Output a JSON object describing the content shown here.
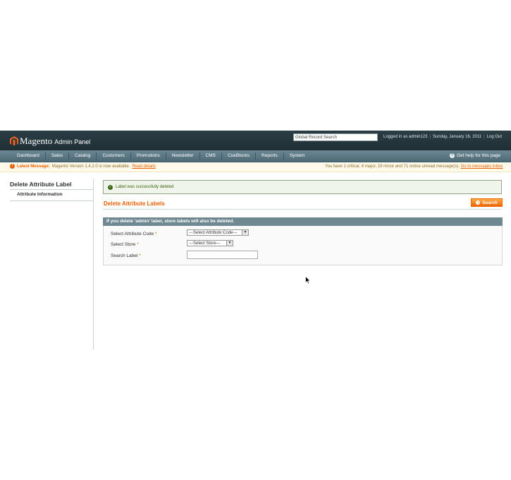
{
  "header": {
    "logo_text": "Magento",
    "logo_sub": "Admin Panel",
    "global_search_value": "Global Record Search",
    "user_info": [
      "Logged in as admin123",
      "Sunday, January 16, 2011",
      "Log Out"
    ]
  },
  "nav": {
    "items": [
      "Dashboard",
      "Sales",
      "Catalog",
      "Customers",
      "Promotions",
      "Newsletter",
      "CMS",
      "CueBlocks",
      "Reports",
      "System"
    ],
    "help_label": "Get help for this page"
  },
  "notice": {
    "label": "Latest Message:",
    "message": "Magento Version 1.4.2.0 is now available.",
    "link": "Read details",
    "right_text": "You have 1 critical, 4 major, 19 minor and 71 notice unread message(s).",
    "right_link": "Go to messages inbox"
  },
  "sidebar": {
    "title": "Delete Attribute Label",
    "tab": "Attribute Information"
  },
  "success_message": "Label was successfully deleted",
  "content": {
    "title": "Delete Attribute Labels",
    "search_button": "Search",
    "fieldset_legend": "If you delete 'admin' label, store labels will also be deleted.",
    "fields": {
      "attribute_code_label": "Select Attribute Code",
      "attribute_code_value": "---Select Attribute Code---",
      "store_label": "Select Store",
      "store_value": "---Select Store---",
      "search_label": "Search Label",
      "required_mark": "*"
    }
  },
  "colors": {
    "header_bg": "#24363d",
    "nav_bg": "#5b7682",
    "accent": "#eb5e00",
    "success": "#3d6611"
  }
}
